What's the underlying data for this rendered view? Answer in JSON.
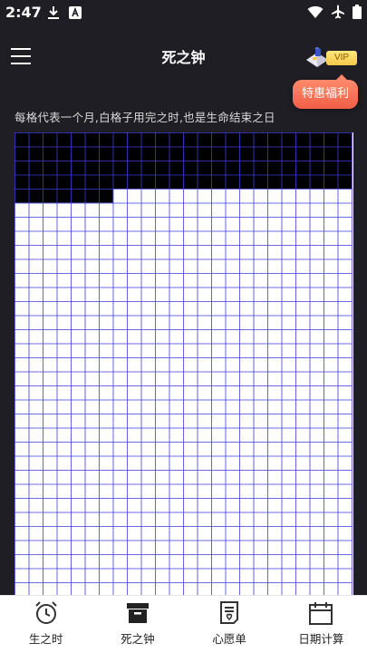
{
  "status_bar": {
    "time": "2:47",
    "icons": [
      "download-icon",
      "notification-a-icon",
      "wifi-icon",
      "airplane-icon",
      "battery-icon"
    ]
  },
  "header": {
    "title": "死之钟",
    "vip_label": "VIP",
    "promo_label": "特惠福利"
  },
  "caption": "每格代表一个月,白格子用完之时,也是生命结束之日",
  "grid": {
    "columns": 24,
    "rows_visible": 33,
    "months_used": 103,
    "used_color": "#000000",
    "remaining_color": "#ffffff",
    "line_color": "#3d3ddb"
  },
  "bottom_nav": [
    {
      "label": "生之时",
      "icon": "alarm-clock-icon",
      "active": false
    },
    {
      "label": "死之钟",
      "icon": "box-icon",
      "active": true
    },
    {
      "label": "心愿单",
      "icon": "wish-list-icon",
      "active": false
    },
    {
      "label": "日期计算",
      "icon": "calendar-icon",
      "active": false
    }
  ]
}
